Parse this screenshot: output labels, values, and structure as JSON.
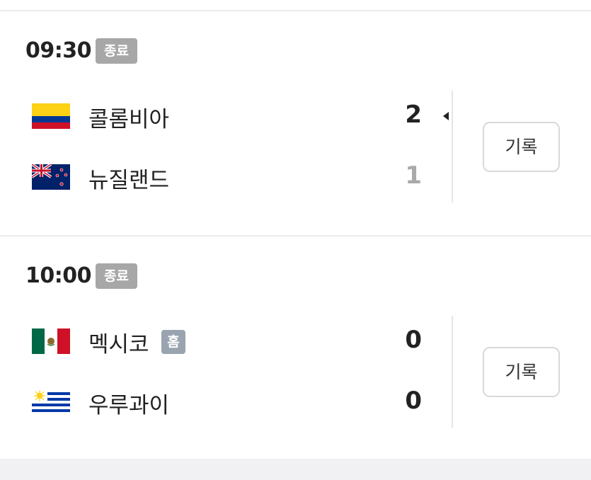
{
  "matches": [
    {
      "time": "09:30",
      "status": "종료",
      "teams": [
        {
          "name": "콜롬비아",
          "score": "2",
          "flag": "colombia-flag",
          "result": "win"
        },
        {
          "name": "뉴질랜드",
          "score": "1",
          "flag": "new-zealand-flag",
          "result": "lose"
        }
      ],
      "record_label": "기록"
    },
    {
      "time": "10:00",
      "status": "종료",
      "home_label": "홈",
      "teams": [
        {
          "name": "멕시코",
          "score": "0",
          "flag": "mexico-flag",
          "result": "tie",
          "home": true
        },
        {
          "name": "우루과이",
          "score": "0",
          "flag": "uruguay-flag",
          "result": "tie"
        }
      ],
      "record_label": "기록"
    }
  ],
  "colors": {
    "status_badge_bg": "#a7a7a7",
    "home_badge_bg": "#9aa3b0",
    "losing_score": "#a9a9a9",
    "divider": "#ececec"
  }
}
